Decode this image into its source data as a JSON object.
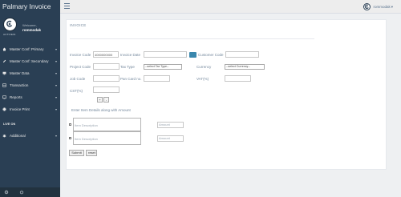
{
  "app": {
    "brand": "Palmary Invoice",
    "logo_caption": "ACTIVEIN"
  },
  "profile": {
    "welcome": "Welcome,",
    "username": "rommodak"
  },
  "sidebar": {
    "items": [
      {
        "label": "Master Conf: Primary",
        "icon": "home-icon"
      },
      {
        "label": "Master Conf: Secondary",
        "icon": "edit-icon"
      },
      {
        "label": "Master Data",
        "icon": "desktop-icon"
      },
      {
        "label": "Transaction",
        "icon": "table-icon"
      },
      {
        "label": "Reports",
        "icon": "chart-icon"
      },
      {
        "label": "Invoice Print",
        "icon": "print-icon"
      }
    ],
    "live_label": "LIVE ON",
    "additional": {
      "label": "Additional",
      "icon": "bug-icon"
    }
  },
  "topnav": {
    "user": "rommodak"
  },
  "panel": {
    "title": "INVOICE",
    "fields": {
      "invoice_code_label": "Invoice Code",
      "invoice_code_value": "4000000000",
      "invoice_date_label": "Invoice Date",
      "customer_code_label": "Customer Code",
      "project_code_label": "Project Code",
      "tax_type_label": "Tax Type",
      "tax_type_selected": "--select Tax Type--",
      "currency_label": "Currency",
      "currency_selected": "--select Currency--",
      "job_code_label": "Job Code",
      "pan_card_label": "Pan Card no.",
      "vat_label": "VAT(%)",
      "cst_label": "CST(%)"
    },
    "stepper": {
      "plus": "+",
      "minus": "-"
    },
    "items_note": "Enter Item Details along with Amount",
    "items": [
      {
        "description_placeholder": "Item Description",
        "amount_placeholder": "Amount"
      },
      {
        "description_placeholder": "Item Description",
        "amount_placeholder": "Amount"
      }
    ],
    "submit_label": "Submit",
    "reset_label": "reset"
  },
  "colors": {
    "sidebar": "#2a3f54",
    "topnav": "#ededed",
    "panel": "#ffffff",
    "calendar_accent": "#3a87ad"
  }
}
